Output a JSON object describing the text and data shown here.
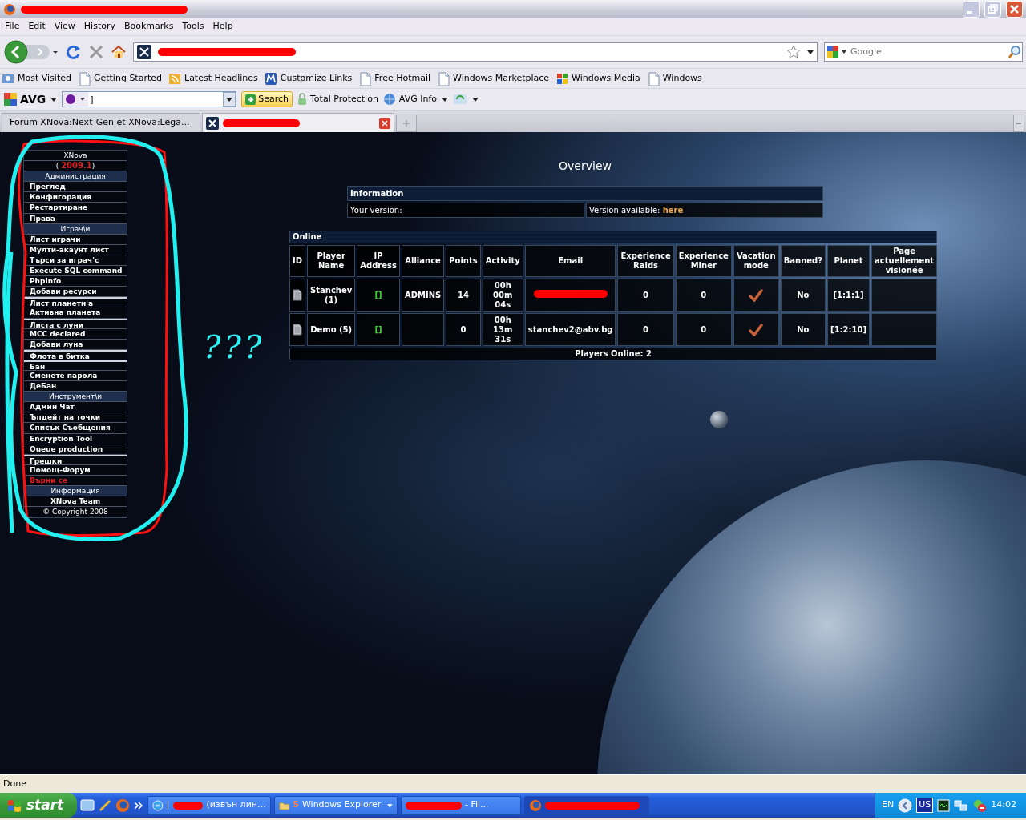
{
  "window": {
    "title_redacted": true
  },
  "menu": [
    "File",
    "Edit",
    "View",
    "History",
    "Bookmarks",
    "Tools",
    "Help"
  ],
  "navigation": {
    "address_redacted": true,
    "search_placeholder": "Google"
  },
  "bookmarks": [
    {
      "label": "Most Visited",
      "kind": "folder"
    },
    {
      "label": "Getting Started",
      "kind": "page"
    },
    {
      "label": "Latest Headlines",
      "kind": "rss"
    },
    {
      "label": "Customize Links",
      "kind": "brand"
    },
    {
      "label": "Free Hotmail",
      "kind": "page"
    },
    {
      "label": "Windows Marketplace",
      "kind": "page"
    },
    {
      "label": "Windows Media",
      "kind": "windows"
    },
    {
      "label": "Windows",
      "kind": "page"
    }
  ],
  "avg_toolbar": {
    "brand": "AVG",
    "search_value": "]",
    "search_button": "Search",
    "items": [
      "Total Protection",
      "AVG Info"
    ]
  },
  "tabs": [
    {
      "label": "Forum XNova:Next-Gen et XNova:Lega...",
      "selected": false,
      "redacted": false
    },
    {
      "selected": true,
      "redacted": true
    }
  ],
  "sidebar": {
    "items": [
      {
        "kind": "title",
        "label": "XNova"
      },
      {
        "kind": "version",
        "open": "(",
        "value": "2009.1",
        "close": ")"
      },
      {
        "kind": "section",
        "label": "Администрация"
      },
      {
        "kind": "link",
        "label": "Преглед"
      },
      {
        "kind": "link",
        "label": "Конфигорация"
      },
      {
        "kind": "link",
        "label": "Рестартиране"
      },
      {
        "kind": "link",
        "label": "Права"
      },
      {
        "kind": "section",
        "label": "Играч\\и"
      },
      {
        "kind": "link",
        "label": "Лист играчи"
      },
      {
        "kind": "link",
        "label": "Мулти-акаунт лист"
      },
      {
        "kind": "link",
        "label": "Търси за играч'с"
      },
      {
        "kind": "link",
        "label": "Execute SQL command"
      },
      {
        "kind": "link",
        "label": "PhpInfo"
      },
      {
        "kind": "link",
        "label": "Добави ресурси"
      },
      {
        "kind": "link",
        "label": "Лист планети'а",
        "break_before": true
      },
      {
        "kind": "link",
        "label": "Активна планета"
      },
      {
        "kind": "link",
        "label": "Листа с луни",
        "break_before": true
      },
      {
        "kind": "link",
        "label": "MCC declared"
      },
      {
        "kind": "link",
        "label": "Добави луна"
      },
      {
        "kind": "link",
        "label": "Флота в битка",
        "break_before": true
      },
      {
        "kind": "link",
        "label": "Бан",
        "break_before": true
      },
      {
        "kind": "link",
        "label": "Сменете парола"
      },
      {
        "kind": "link",
        "label": "ДеБан"
      },
      {
        "kind": "section",
        "label": "Инструмент\\и"
      },
      {
        "kind": "link",
        "label": "Админ Чат"
      },
      {
        "kind": "link",
        "label": "Ъпдейт на точки"
      },
      {
        "kind": "link",
        "label": "Списък Съобщения"
      },
      {
        "kind": "link",
        "label": "Encryption Tool"
      },
      {
        "kind": "link",
        "label": "Queue production"
      },
      {
        "kind": "link",
        "label": "Грешки",
        "break_before": true
      },
      {
        "kind": "link",
        "label": "Помощ-Форум"
      },
      {
        "kind": "logout",
        "label": "Върни се"
      },
      {
        "kind": "section",
        "label": "Информация"
      },
      {
        "kind": "footer",
        "label": "XNova Team"
      },
      {
        "kind": "copyright",
        "label": "© Copyright 2008"
      }
    ]
  },
  "annotation": {
    "text": "???"
  },
  "overview": {
    "title": "Overview",
    "info": {
      "heading": "Information",
      "version_label": "Your version:",
      "available_label": "Version available:",
      "available_link": "here"
    },
    "online": {
      "heading": "Online",
      "columns": [
        "ID",
        "Player Name",
        "IP Address",
        "Alliance",
        "Points",
        "Activity",
        "Email",
        "Experience Raids",
        "Experience Miner",
        "Vacation mode",
        "Banned?",
        "Planet",
        "Page actuellement visionée"
      ],
      "rows": [
        {
          "player": "Stanchev (1)",
          "ip": "[]",
          "alliance": "ADMINS",
          "points": "14",
          "activity": "00h 00m 04s",
          "email_redacted": true,
          "raids": "0",
          "miner": "0",
          "vacation": true,
          "banned": "No",
          "planet": "[1:1:1]"
        },
        {
          "player": "Demo (5)",
          "ip": "[]",
          "points": "0",
          "activity": "00h 13m 31s",
          "email": "stanchev2@abv.bg",
          "email_redacted": false,
          "raids": "0",
          "miner": "0",
          "vacation": true,
          "banned": "No",
          "planet": "[1:2:10]"
        }
      ],
      "footer": "Players Online: 2"
    }
  },
  "status_bar": {
    "text": "Done"
  },
  "taskbar": {
    "start": "start",
    "tasks": [
      {
        "prefix": "|",
        "redacted": true,
        "label": "(извън лин…",
        "selected": false
      },
      {
        "count": "5",
        "label": "Windows Explorer",
        "dropdown": true,
        "redacted": false,
        "selected": false
      },
      {
        "redacted": true,
        "label": "- Fil...",
        "selected": false
      },
      {
        "redacted": true,
        "selected": true
      }
    ],
    "tray": {
      "language": "EN",
      "layout": "US",
      "time": "14:02"
    }
  }
}
